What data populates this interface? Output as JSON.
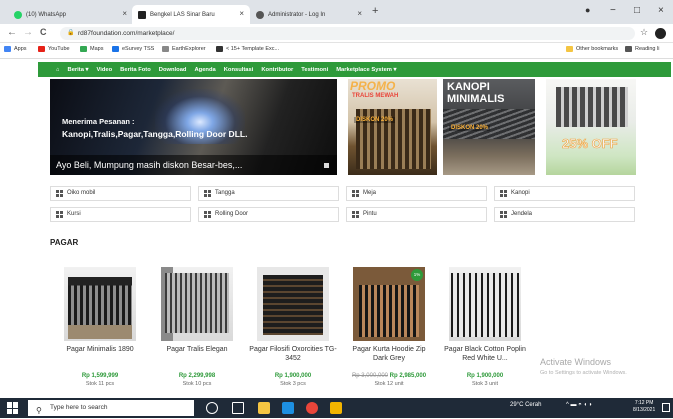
{
  "browser": {
    "tabs": [
      {
        "label": "(10) WhatsApp",
        "color": "#25d366",
        "close": "×"
      },
      {
        "label": "Bengkel LAS Sinar Baru",
        "color": "#222222",
        "close": "×"
      },
      {
        "label": "Administrator - Log In",
        "color": "#555555",
        "close": "×"
      }
    ],
    "new_tab": "+",
    "win_controls": [
      "●",
      "−",
      "□"
    ],
    "nav": {
      "back": "←",
      "forward": "→",
      "reload": "C"
    },
    "url": "rd87foundation.com/marketplace/",
    "star": "☆",
    "bookmarks": [
      {
        "label": "Apps",
        "color": "#4285f4"
      },
      {
        "label": "YouTube",
        "color": "#e62117"
      },
      {
        "label": "Maps",
        "color": "#34a853"
      },
      {
        "label": "eSurvey TSS",
        "color": "#1a73e8"
      },
      {
        "label": "EarthExplorer",
        "color": "#888888"
      },
      {
        "label": "< 15+ Template Exc...",
        "color": "#333333"
      }
    ],
    "other_bookmarks": "Other bookmarks",
    "reading_list": "Reading li"
  },
  "site_nav": [
    "⌂",
    "Berita ▾",
    "Video",
    "Berita Foto",
    "Download",
    "Agenda",
    "Konsultasi",
    "Kontributor",
    "Testimoni",
    "Marketplace System ▾"
  ],
  "hero": {
    "line1": "Menerima Pesanan :",
    "line2": "Kanopi,Tralis,Pagar,Tangga,Rolling Door DLL.",
    "caption": "Ayo Beli, Mumpung masih diskon Besar-bes,..."
  },
  "promo": {
    "title": "PROMO",
    "sub": "TRALIS MEWAH",
    "discount": "DISKON 20%"
  },
  "kanopi": {
    "title1": "KANOPI",
    "title2": "MINIMALIS",
    "discount": "DISKON 20%"
  },
  "off_banner": {
    "text": "25% OFF"
  },
  "categories": [
    "Oiko mobil",
    "Tangga",
    "Meja",
    "Kanopi",
    "Kursi",
    "Rolling Door",
    "Pintu",
    "Jendela"
  ],
  "section_title": "PAGAR",
  "products": [
    {
      "name": "Pagar Minimalis 1890",
      "price": "Rp 1,599,999",
      "old_price": "",
      "stock": "Stok 11 pcs"
    },
    {
      "name": "Pagar Tralis Elegan",
      "price": "Rp 2,299,998",
      "old_price": "",
      "stock": "Stok 10 pcs"
    },
    {
      "name": "Pagar Filosifi Oxorcities TG-3452",
      "price": "Rp 1,900,000",
      "old_price": "",
      "stock": "Stok 3 pcs"
    },
    {
      "name": "Pagar Kurta Hoodie Zip Dark Grey",
      "price": "Rp 2,985,000",
      "old_price": "Rp 3,000,000",
      "stock": "Stok 12 unit",
      "badge": "1%"
    },
    {
      "name": "Pagar Black Cotton Poplin Red White U...",
      "price": "Rp 1,900,000",
      "old_price": "",
      "stock": "Stok 3 unit"
    }
  ],
  "activate": {
    "title": "Activate Windows",
    "sub": "Go to Settings to activate Windows."
  },
  "taskbar": {
    "search_placeholder": "Type here to search",
    "weather": "29°C Cerah",
    "time": "7:12 PM",
    "date": "8/13/2021"
  }
}
